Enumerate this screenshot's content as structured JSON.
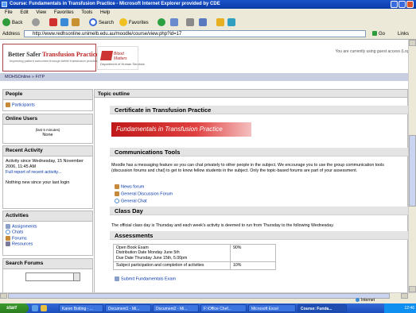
{
  "window": {
    "title": "Course: Fundamentals in Transfusion Practice - Microsoft Internet Explorer provided by CDE"
  },
  "menu": [
    "File",
    "Edit",
    "View",
    "Favorites",
    "Tools",
    "Help"
  ],
  "toolbar": {
    "back": "Back",
    "search": "Search",
    "favorites": "Favorites"
  },
  "address": {
    "label": "Address",
    "url": "http://www.redhsonline.unimelb.edu.au/moodle/course/view.php?id=17",
    "go": "Go",
    "links": "Links"
  },
  "header": {
    "logo_title_a": "Better Safer ",
    "logo_title_b": "Transfusion Practice",
    "logo_subtitle": "Improving patient outcomes through better transfusion practice",
    "logo2_text": "Blood Matters",
    "logo2_sub": "Department of Human Services",
    "logged_in": "You are currently using guest access (Login)"
  },
  "breadcrumb": "MOHSOnline » FiTP",
  "sidebar": {
    "people": {
      "title": "People",
      "items": [
        "Participants"
      ]
    },
    "online": {
      "title": "Online Users",
      "note": "(last 5 minutes)",
      "value": "None"
    },
    "recent": {
      "title": "Recent Activity",
      "since": "Activity since Wednesday, 15 November 2006, 11:45 AM",
      "full_report": "Full report of recent activity...",
      "nothing": "Nothing new since your last login"
    },
    "activities": {
      "title": "Activities",
      "items": [
        "Assignments",
        "Chats",
        "Forums",
        "Resources"
      ]
    },
    "search": {
      "title": "Search Forums"
    }
  },
  "main": {
    "topic_outline": "Topic outline",
    "cert_heading": "Certificate in Transfusion Practice",
    "banner": "Fundamentals in Transfusion Practice",
    "comm_heading": "Communications Tools",
    "comm_text": "Moodle has a messaging feature so you can chat privately to other people in the subject. We encourage you to use the group communication tools (discussion forums and chat) to get to know fellow students in the subject. Only the topic-based forums are part of your assessment.",
    "comm_links": [
      "News forum",
      "General Discussion Forum",
      "General Chat"
    ],
    "classday_heading": "Class Day",
    "classday_text": "The official class day is Thursday and each week's activity is deemed to run from Thursday to the following Wednesday.",
    "assess_heading": "Assessments",
    "assess_rows": [
      {
        "desc": [
          "Open Book Exam",
          "Distribution Date  Monday June 5th",
          "Due Date  Thursday June 15th, 5.00pm"
        ],
        "weight": "90%"
      },
      {
        "desc": [
          "Subject participation and completion of activities"
        ],
        "weight": "10%"
      }
    ],
    "submit_link": "Submit Fundamentals Exam"
  },
  "status": {
    "zone": "Internet"
  },
  "taskbar": {
    "start": "start",
    "tasks": [
      "Karen Botting - ...",
      "Document1 - Mi...",
      "Document2 - Mi...",
      "F:\\Office Chef...",
      "Microsoft Excel",
      "Course: Funda..."
    ],
    "clock": "12:46"
  }
}
